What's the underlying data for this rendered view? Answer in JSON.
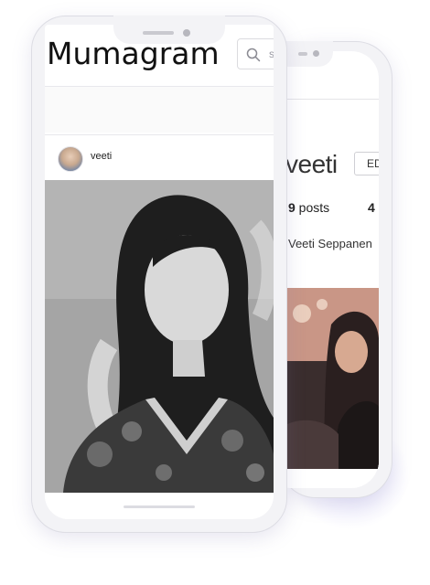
{
  "front": {
    "app_title": "Mumagram",
    "search_placeholder": "s",
    "post": {
      "username": "veeti"
    }
  },
  "back": {
    "profile": {
      "username": "veeti",
      "edit_label": "ED",
      "posts_count": "9",
      "posts_label": " posts",
      "followers_count": "4",
      "full_name": "Veeti Seppanen"
    }
  },
  "icons": [
    "search-icon",
    "avatar-image"
  ],
  "colors": {
    "phone_frame": "#f3f3f6",
    "accent_glow": "#bfb9f5"
  }
}
